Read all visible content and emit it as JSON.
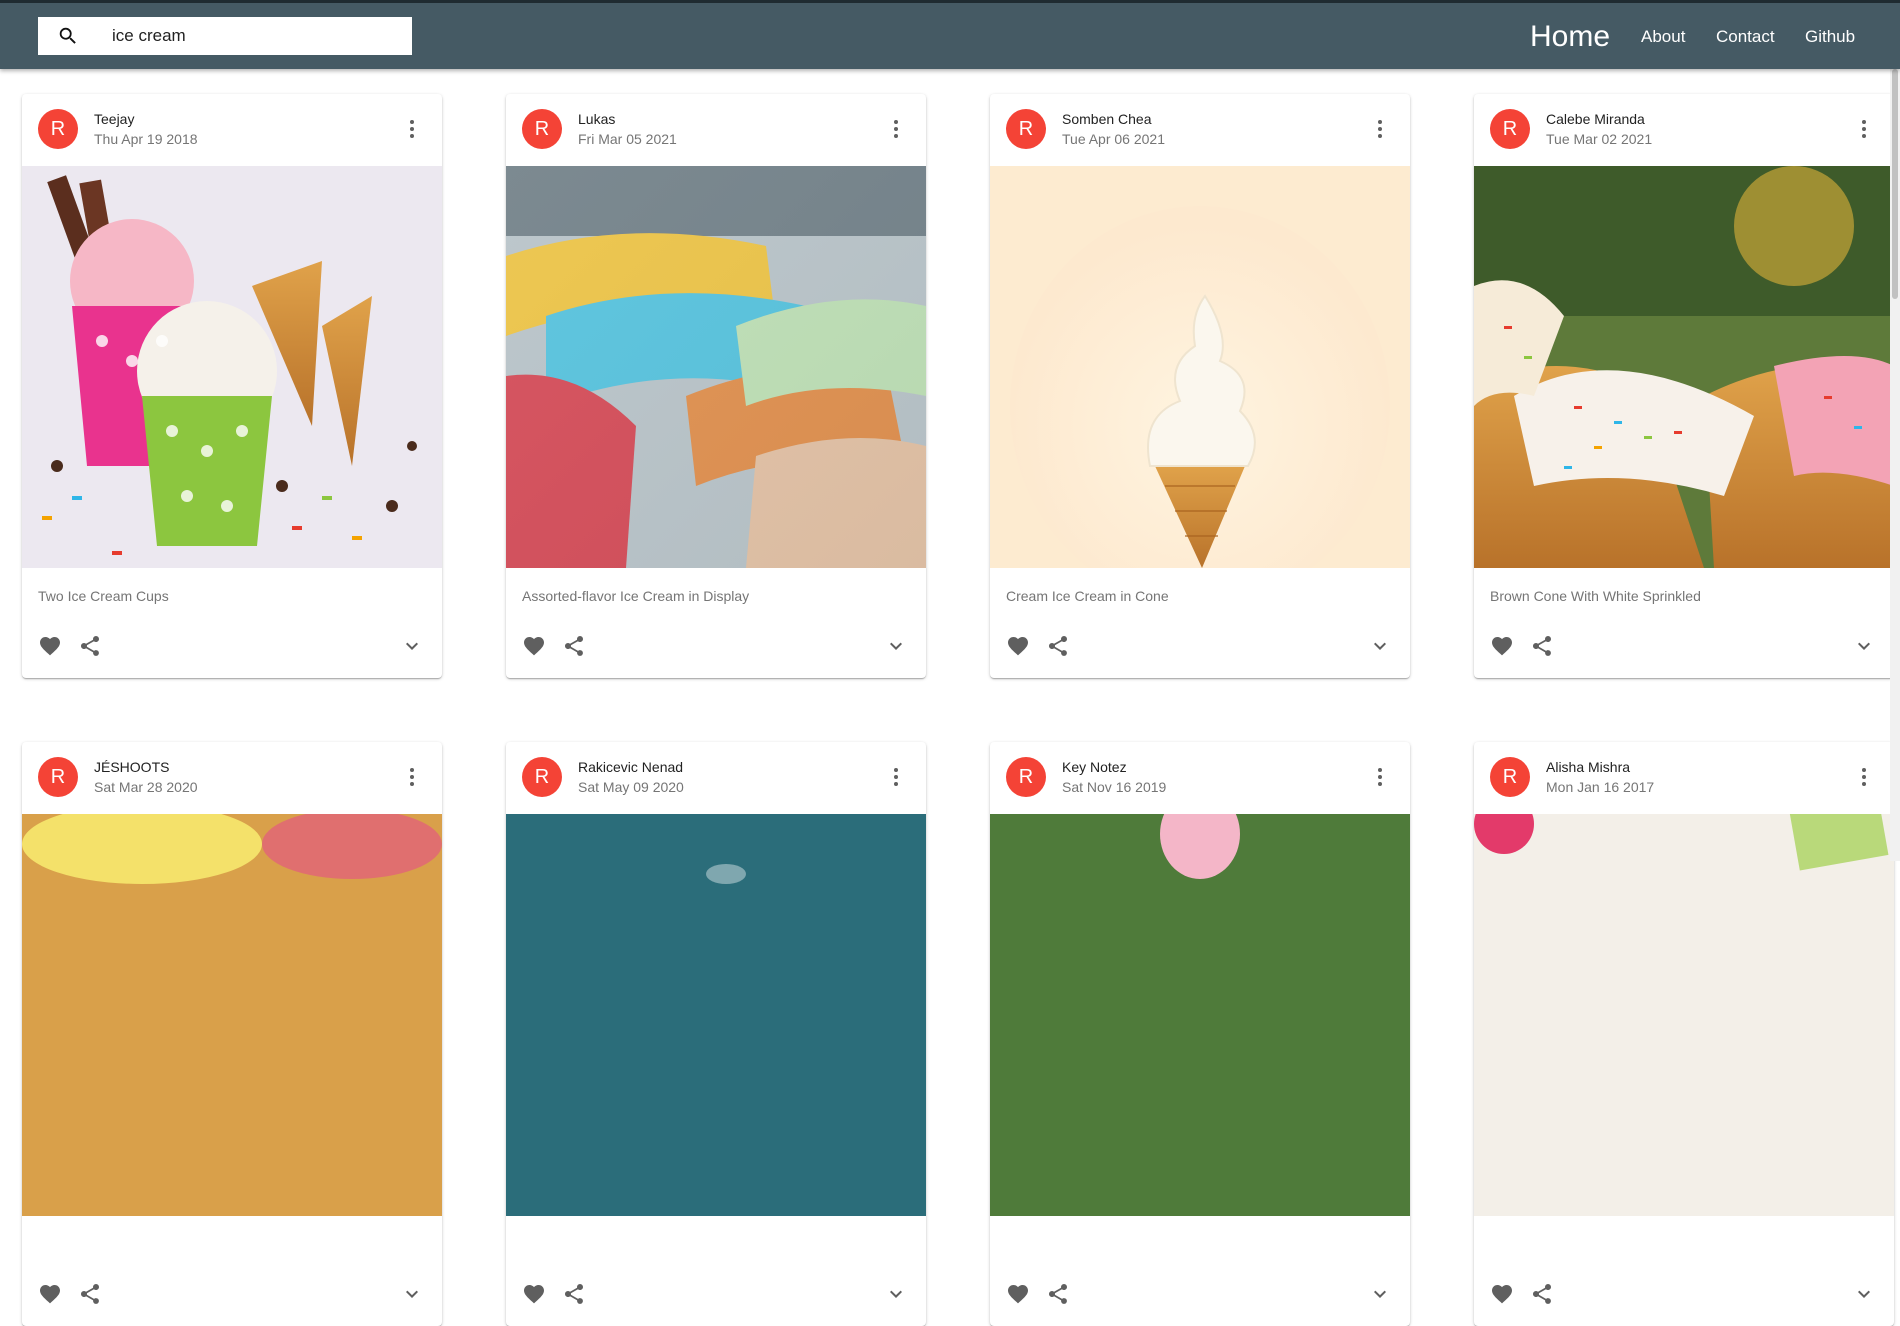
{
  "search": {
    "value": "ice cream",
    "icon": "search-icon"
  },
  "nav": {
    "home": "Home",
    "about": "About",
    "contact": "Contact",
    "github": "Github"
  },
  "colors": {
    "appbar": "#455a64",
    "avatar": "#f44336"
  },
  "cards": [
    {
      "avatar": "R",
      "author": "Teejay",
      "date": "Thu Apr 19 2018",
      "caption": "Two Ice Cream Cups"
    },
    {
      "avatar": "R",
      "author": "Lukas",
      "date": "Fri Mar 05 2021",
      "caption": "Assorted-flavor Ice Cream in Display"
    },
    {
      "avatar": "R",
      "author": "Somben Chea",
      "date": "Tue Apr 06 2021",
      "caption": "Cream Ice Cream in Cone"
    },
    {
      "avatar": "R",
      "author": "Calebe Miranda",
      "date": "Tue Mar 02 2021",
      "caption": "Brown Cone With White Sprinkled"
    },
    {
      "avatar": "R",
      "author": "JÉSHOOTS",
      "date": "Sat Mar 28 2020",
      "caption": ""
    },
    {
      "avatar": "R",
      "author": "Rakicevic Nenad",
      "date": "Sat May 09 2020",
      "caption": ""
    },
    {
      "avatar": "R",
      "author": "Key Notez",
      "date": "Sat Nov 16 2019",
      "caption": ""
    },
    {
      "avatar": "R",
      "author": "Alisha Mishra",
      "date": "Mon Jan 16 2017",
      "caption": ""
    }
  ]
}
